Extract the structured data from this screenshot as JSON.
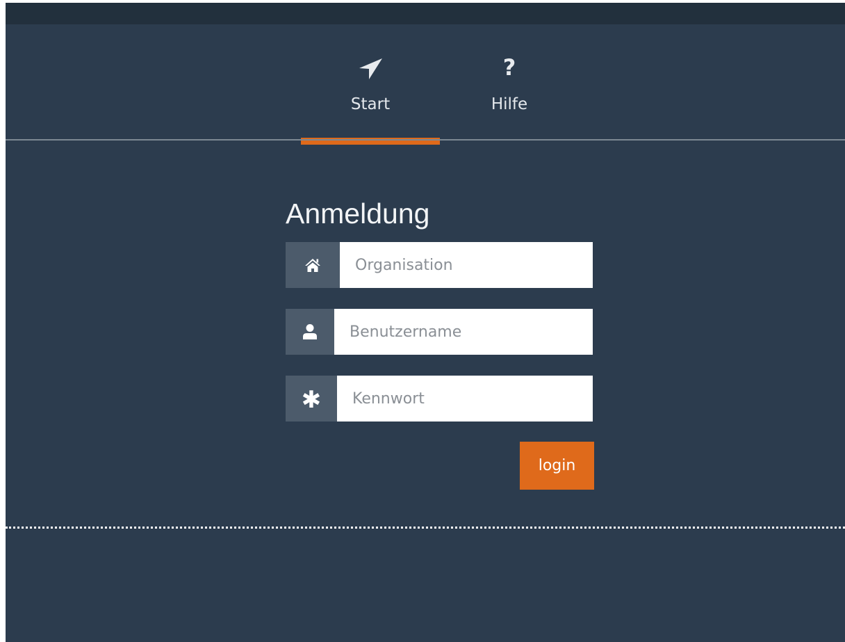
{
  "nav": {
    "tabs": [
      {
        "label": "Start",
        "icon": "location-arrow-icon",
        "active": true
      },
      {
        "label": "Hilfe",
        "icon": "question-mark-icon",
        "active": false
      }
    ],
    "help_glyph": "?"
  },
  "login": {
    "title": "Anmeldung",
    "organisation": {
      "placeholder": "Organisation",
      "value": "",
      "icon": "home-icon"
    },
    "username": {
      "placeholder": "Benutzername",
      "value": "",
      "icon": "user-icon"
    },
    "password": {
      "placeholder": "Kennwort",
      "value": "",
      "icon": "asterisk-icon",
      "glyph": "✱"
    },
    "button_label": "login"
  },
  "colors": {
    "background": "#2c3c4e",
    "topbar": "#22303d",
    "accent": "#df6a1b",
    "addon": "#4c5b6b"
  }
}
